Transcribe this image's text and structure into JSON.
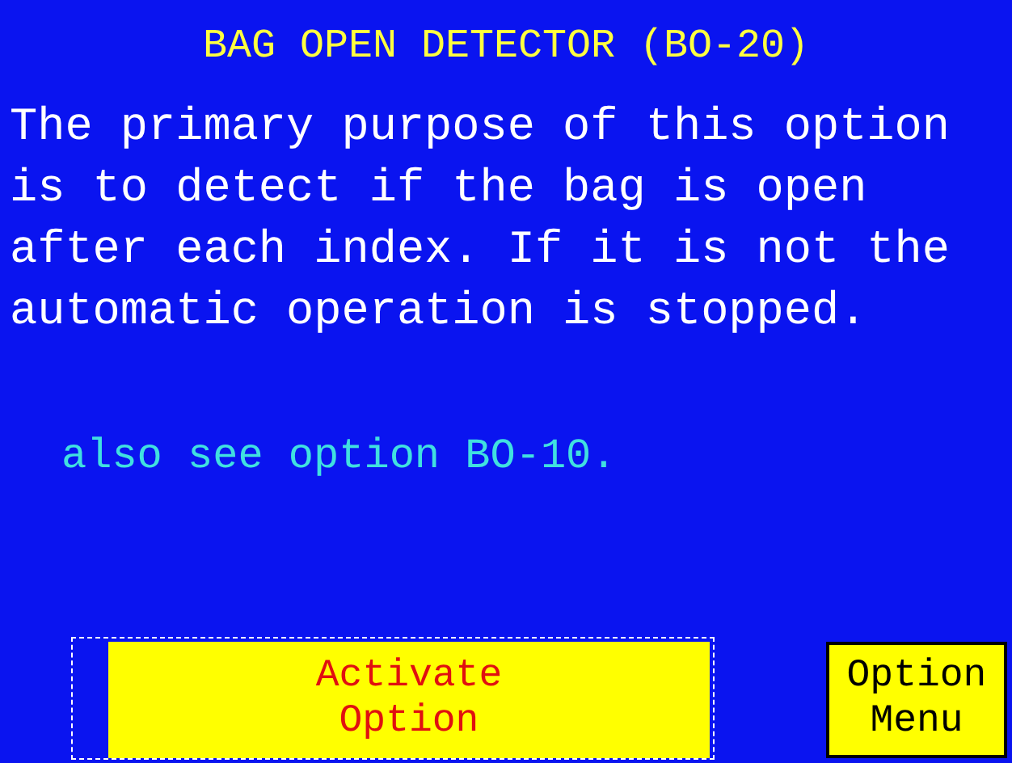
{
  "title": "BAG OPEN DETECTOR (BO-20)",
  "description": "The primary purpose of this option is to detect if the bag is open after each index. If it is not the automatic operation is stopped.",
  "note": "also see option BO-10.",
  "buttons": [
    {
      "label": "Activate\nOption",
      "kind": "activate",
      "focused": true
    },
    {
      "label": "Option\nMenu",
      "kind": "menu",
      "focused": false
    }
  ]
}
